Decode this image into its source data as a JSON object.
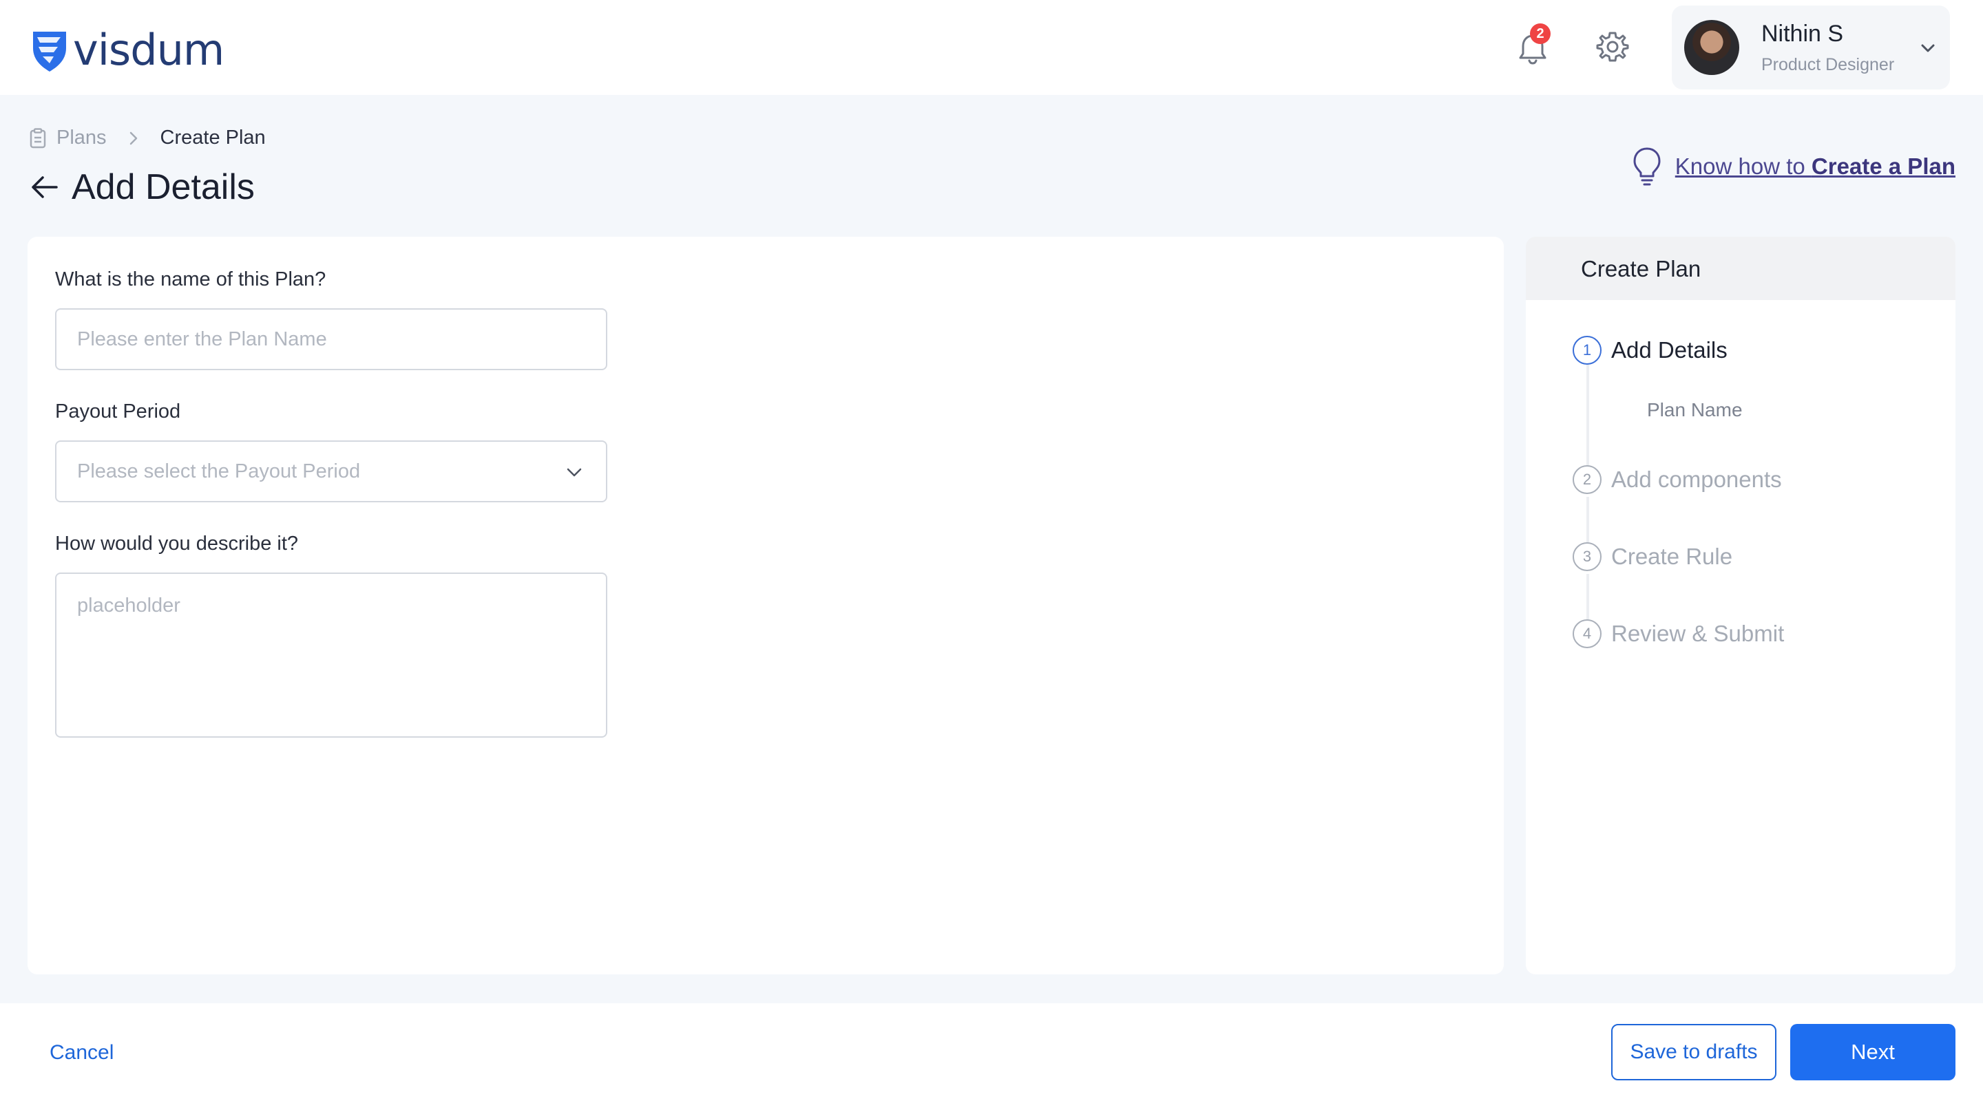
{
  "header": {
    "logo_text": "visdum",
    "notification_count": "2",
    "user": {
      "name": "Nithin S",
      "role": "Product Designer"
    }
  },
  "breadcrumb": {
    "parent": "Plans",
    "current": "Create Plan"
  },
  "page": {
    "title": "Add Details"
  },
  "help": {
    "prefix": "Know how to ",
    "link": "Create a Plan"
  },
  "form": {
    "plan_name": {
      "label": "What is the name of this Plan?",
      "placeholder": "Please enter the Plan Name",
      "value": ""
    },
    "payout_period": {
      "label": "Payout Period",
      "placeholder": "Please select the Payout Period",
      "value": ""
    },
    "description": {
      "label": "How would you describe it?",
      "placeholder": "placeholder",
      "value": ""
    }
  },
  "steps": {
    "title": "Create Plan",
    "items": [
      {
        "number": "1",
        "label": "Add Details",
        "active": true,
        "substeps": [
          "Plan Name"
        ]
      },
      {
        "number": "2",
        "label": "Add components",
        "active": false
      },
      {
        "number": "3",
        "label": "Create Rule",
        "active": false
      },
      {
        "number": "4",
        "label": "Review & Submit",
        "active": false
      }
    ]
  },
  "footer": {
    "cancel": "Cancel",
    "save_drafts": "Save to drafts",
    "next": "Next"
  },
  "colors": {
    "primary": "#1e6ef0",
    "link": "#1e66d9",
    "brand": "#243c74",
    "badge": "#ef4444",
    "help_link": "#4b4790",
    "page_bg": "#f4f7fb"
  }
}
